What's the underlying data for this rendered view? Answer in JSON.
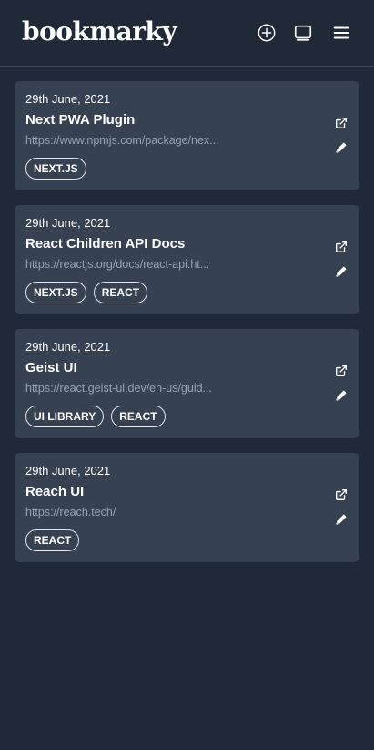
{
  "app": {
    "logo": "bookmarky"
  },
  "header": {
    "add_icon": "plus-circle-icon",
    "view_icon": "display-icon",
    "menu_icon": "hamburger-menu-icon"
  },
  "bookmarks": [
    {
      "date": "29th June, 2021",
      "title": "Next PWA Plugin",
      "url": "https://www.npmjs.com/package/nex...",
      "tags": [
        "NEXT.JS"
      ]
    },
    {
      "date": "29th June, 2021",
      "title": "React Children API Docs",
      "url": "https://reactjs.org/docs/react-api.ht...",
      "tags": [
        "NEXT.JS",
        "REACT"
      ]
    },
    {
      "date": "29th June, 2021",
      "title": "Geist UI",
      "url": "https://react.geist-ui.dev/en-us/guid...",
      "tags": [
        "UI LIBRARY",
        "REACT"
      ]
    },
    {
      "date": "29th June, 2021",
      "title": "Reach UI",
      "url": "https://reach.tech/",
      "tags": [
        "REACT"
      ]
    }
  ],
  "colors": {
    "background": "#1f2937",
    "card": "#364152",
    "url_text": "#9aa3ae"
  }
}
